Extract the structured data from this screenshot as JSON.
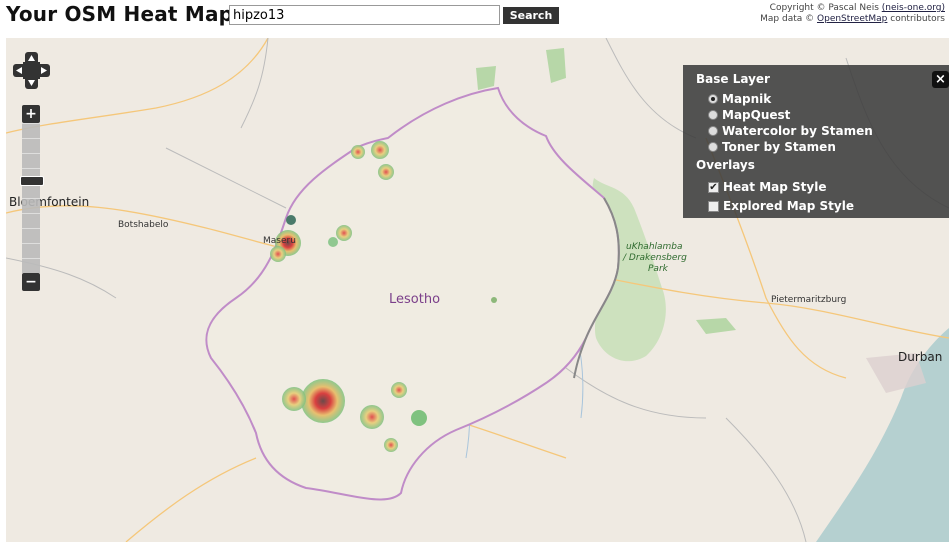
{
  "header": {
    "title": "Your OSM Heat Map:",
    "search_value": "hipzo13",
    "search_button": "Search"
  },
  "credits": {
    "line1_prefix": "Copyright © Pascal Neis ",
    "line1_link": "(neis-one.org)",
    "line2_prefix": "Map data © ",
    "line2_link": "OpenStreetMap",
    "line2_suffix": " contributors"
  },
  "map": {
    "zoom_in": "+",
    "zoom_out": "−",
    "place_labels": {
      "bloemfontein": "Bloemfontein",
      "botshabelo": "Botshabelo",
      "maseru": "Maseru",
      "lesotho": "Lesotho",
      "ukhahlamba_1": "uKhahlamba",
      "ukhahlamba_2": "/ Drakensberg",
      "ukhahlamba_3": "Park",
      "pietermaritzburg": "Pietermaritzburg",
      "durban": "Durban"
    },
    "colors": {
      "land": "#efeae2",
      "sea": "#b5d0d0",
      "border": "#c08cc8",
      "park": "#b7d7a8"
    }
  },
  "layer_switcher": {
    "base_title": "Base Layer",
    "base_layers": [
      {
        "label": "Mapnik",
        "selected": true
      },
      {
        "label": "MapQuest",
        "selected": false
      },
      {
        "label": "Watercolor by Stamen",
        "selected": false
      },
      {
        "label": "Toner by Stamen",
        "selected": false
      }
    ],
    "overlays_title": "Overlays",
    "overlays": [
      {
        "label": "Heat Map Style",
        "checked": true
      },
      {
        "label": "Explored Map Style",
        "checked": false
      }
    ],
    "close": "×"
  }
}
